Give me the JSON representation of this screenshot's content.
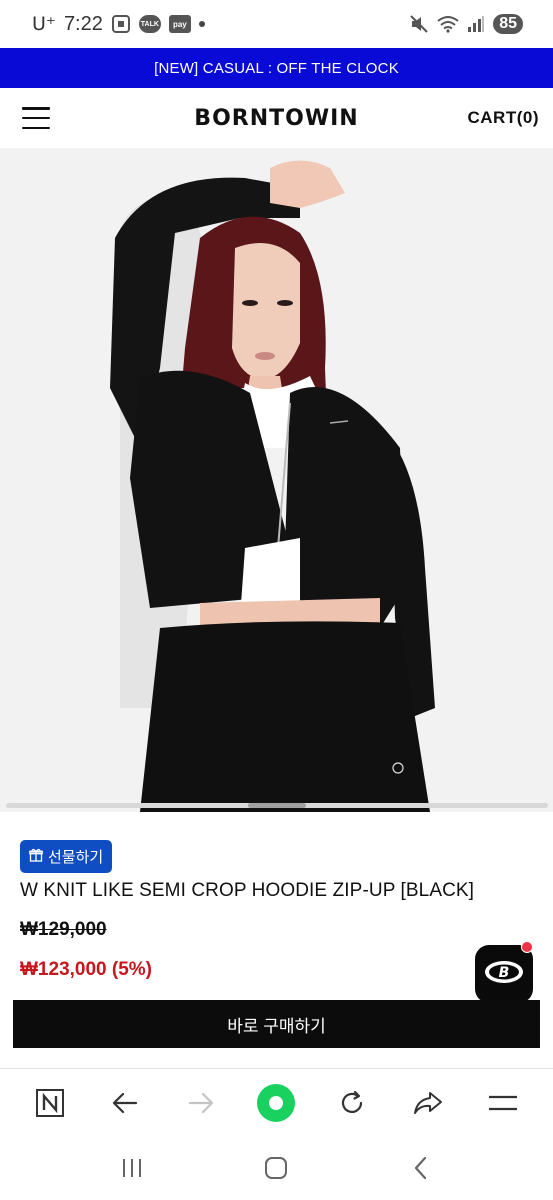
{
  "status_bar": {
    "carrier": "U⁺",
    "time": "7:22",
    "talk_label": "TALK",
    "pay_label": "pay",
    "battery": "85"
  },
  "announcement": "[NEW] CASUAL : OFF THE CLOCK",
  "header": {
    "logo": "BORNTOWIN",
    "cart": "CART(0)"
  },
  "product": {
    "gift_label": "선물하기",
    "name": "W KNIT LIKE SEMI CROP HOODIE ZIP-UP [BLACK]",
    "original_price": "₩129,000",
    "sale_price": "₩123,000 (5%)",
    "buy_label": "바로 구매하기"
  },
  "colors": {
    "announcement_bg": "#0a0ad6",
    "gift_bg": "#0f4ec2",
    "sale_price": "#c8161d",
    "buy_bg": "#0c0c0c",
    "browser_home": "#19d15f"
  },
  "browser_toolbar": [
    "n-icon",
    "back-arrow-icon",
    "forward-arrow-icon",
    "home-dot-icon",
    "refresh-icon",
    "share-icon",
    "menu-icon"
  ],
  "system_nav": [
    "recent-apps-icon",
    "home-icon",
    "back-icon"
  ]
}
